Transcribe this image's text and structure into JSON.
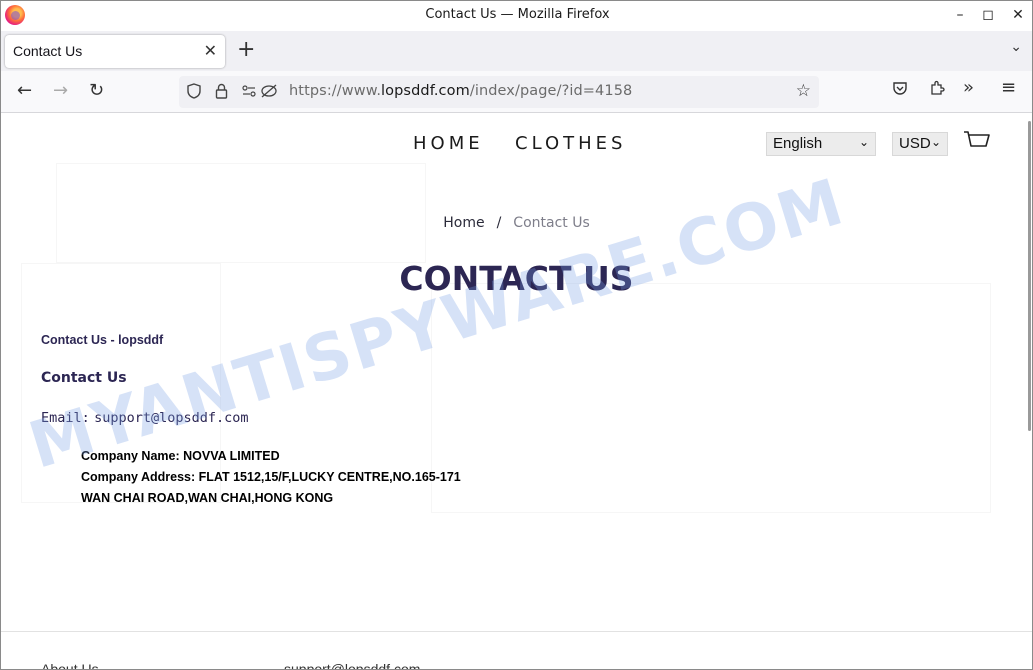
{
  "window": {
    "title": "Contact Us — Mozilla Firefox"
  },
  "tab": {
    "label": "Contact Us"
  },
  "urlbar": {
    "prefix": "https://www.",
    "domain": "lopsddf.com",
    "path": "/index/page/?id=4158"
  },
  "nav": {
    "home": "HOME",
    "clothes": "CLOTHES"
  },
  "language_select": {
    "value": "English"
  },
  "currency_select": {
    "value": "USD"
  },
  "breadcrumb": {
    "home": "Home",
    "separator": "/",
    "current": "Contact Us"
  },
  "page_title": "CONTACT US",
  "content": {
    "subtitle": "Contact Us - lopsddf",
    "heading": "Contact Us",
    "email_label": "Email:",
    "email_value": "support@lopsddf.com",
    "company_name": "Company Name: NOVVA LIMITED",
    "company_address_line1": "Company Address: FLAT 1512,15/F,LUCKY CENTRE,NO.165-171",
    "company_address_line2": "WAN CHAI ROAD,WAN CHAI,HONG KONG"
  },
  "footer": {
    "about": "About Us",
    "email": "support@lopsddf.com"
  },
  "watermark": "MYANTISPYWARE.COM"
}
